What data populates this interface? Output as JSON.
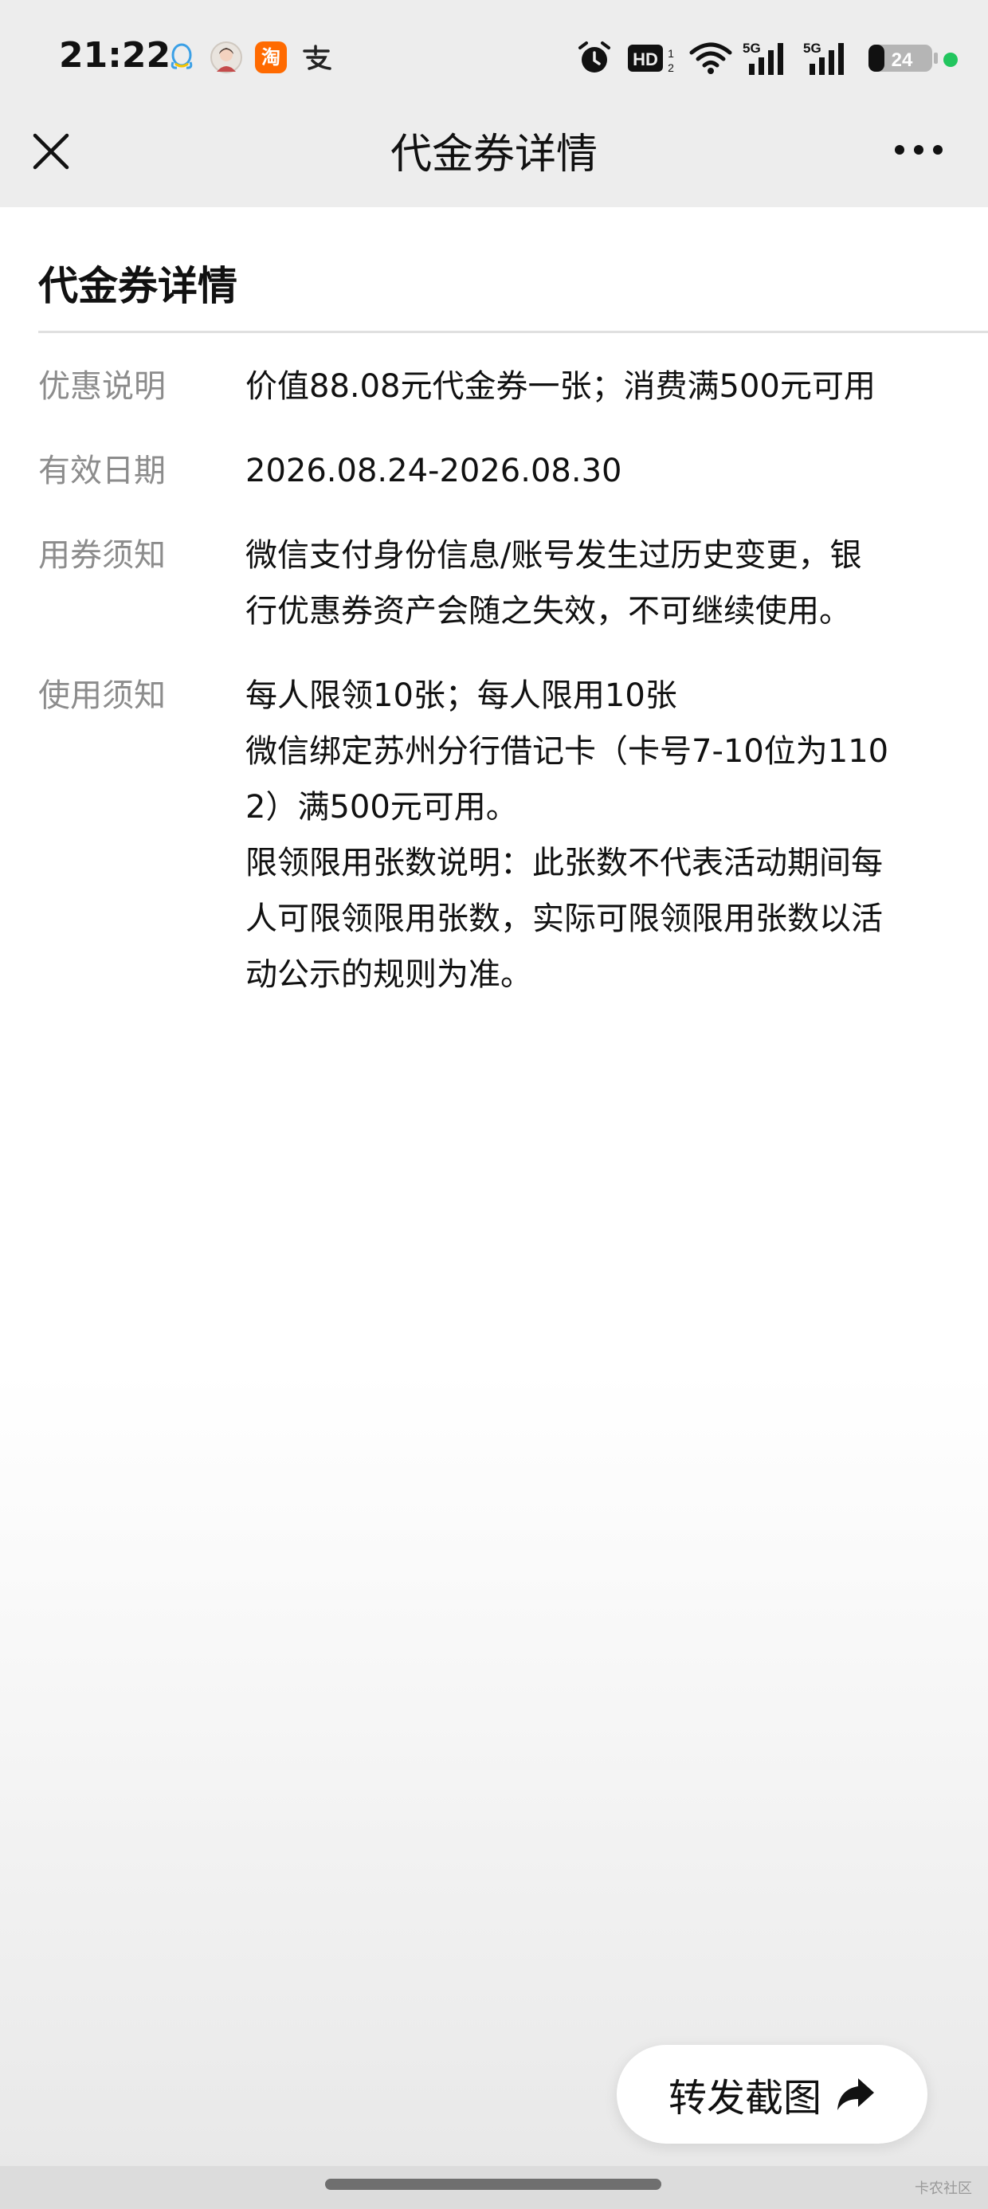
{
  "status_bar": {
    "time": "21:22",
    "taobao_glyph": "淘",
    "battery_level": "24",
    "hd_label": "HD",
    "network_labels": [
      "5G",
      "5G"
    ],
    "left_icons": [
      "qq-icon",
      "avatar-icon",
      "taobao-icon",
      "alipay-icon"
    ],
    "right_icons": [
      "alarm-icon",
      "hd-icon",
      "wifi-icon",
      "signal-5g-icon",
      "signal-5g-icon",
      "battery-icon"
    ],
    "online_dot_color": "#22c55e"
  },
  "nav": {
    "title": "代金券详情",
    "close_icon": "close-icon",
    "more_icon": "more-icon"
  },
  "section": {
    "title": "代金券详情"
  },
  "details": [
    {
      "label": "优惠说明",
      "lines": [
        "价值88.08元代金券一张；消费满500元可用"
      ]
    },
    {
      "label": "有效日期",
      "lines": [
        "2026.08.24-2026.08.30"
      ]
    },
    {
      "label": "用券须知",
      "lines": [
        "微信支付身份信息/账号发生过历史变更，银",
        "行优惠券资产会随之失效，不可继续使用。"
      ]
    },
    {
      "label": "使用须知",
      "lines": [
        "每人限领10张；每人限用10张",
        "微信绑定苏州分行借记卡（卡号7-10位为110",
        "2）满500元可用。",
        "限领限用张数说明：此张数不代表活动期间每",
        "人可限领限用张数，实际可限领限用张数以活",
        "动公示的规则为准。"
      ]
    }
  ],
  "share": {
    "label": "转发截图",
    "icon": "share-arrow-icon"
  },
  "watermark": "卡农社区"
}
